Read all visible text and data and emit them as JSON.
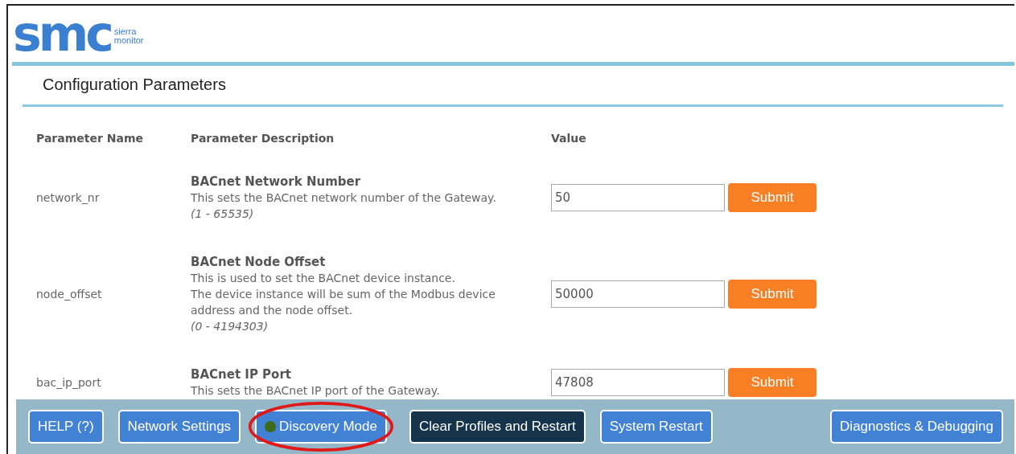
{
  "logo": {
    "mark": "smc",
    "line1": "sierra",
    "line2": "monitor"
  },
  "section_title": "Configuration Parameters",
  "table": {
    "columns": [
      "Parameter Name",
      "Parameter Description",
      "Value"
    ],
    "rows": [
      {
        "name": "network_nr",
        "title": "BACnet Network Number",
        "lines": [
          "This sets the BACnet network number of the Gateway."
        ],
        "range": "(1 - 65535)",
        "value": "50",
        "button": "Submit"
      },
      {
        "name": "node_offset",
        "title": "BACnet Node Offset",
        "lines": [
          "This is used to set the BACnet device instance.",
          "The device instance will be sum of the Modbus device",
          "address and the node offset."
        ],
        "range": "(0 - 4194303)",
        "value": "50000",
        "button": "Submit"
      },
      {
        "name": "bac_ip_port",
        "title": "BACnet IP Port",
        "lines": [
          "This sets the BACnet IP port of the Gateway."
        ],
        "value": "47808",
        "button": "Submit"
      }
    ]
  },
  "footer_buttons": [
    {
      "label": "HELP (?)",
      "kind": "primary",
      "led": false,
      "circled": false
    },
    {
      "label": "Network Settings",
      "kind": "primary",
      "led": false,
      "circled": false
    },
    {
      "label": "Discovery Mode",
      "kind": "primary",
      "led": true,
      "circled": true
    },
    {
      "label": "Clear Profiles and Restart",
      "kind": "dark",
      "led": false,
      "circled": false
    },
    {
      "label": "System Restart",
      "kind": "primary",
      "led": false,
      "circled": false
    },
    {
      "label": "Diagnostics & Debugging",
      "kind": "primary",
      "led": false,
      "circled": false
    }
  ]
}
